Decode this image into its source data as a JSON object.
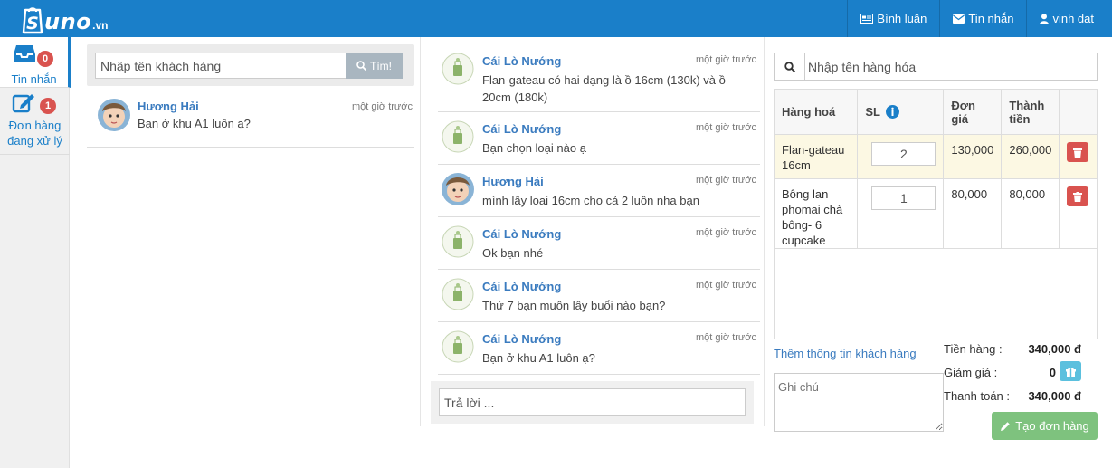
{
  "brand": {
    "name": "uno",
    "suffix": ".vn"
  },
  "topnav": {
    "comments": "Bình luận",
    "messages": "Tin nhắn",
    "user": "vinh dat"
  },
  "rail": [
    {
      "label": "Tin nhắn",
      "count": "0"
    },
    {
      "label_line1": "Đơn hàng",
      "label_line2": "đang xử lý",
      "count": "1"
    }
  ],
  "customers": {
    "search_placeholder": "Nhập tên khách hàng",
    "find_label": "Tìm!",
    "items": [
      {
        "name": "Hương Hải",
        "message": "Bạn ở khu A1 luôn ạ?",
        "time": "một giờ trước"
      }
    ]
  },
  "conversation": {
    "messages": [
      {
        "name": "Cái Lò Nướng",
        "text": "Flan-gateau có hai dạng là ồ 16cm (130k) và ồ 20cm (180k)",
        "time": "một giờ trước",
        "avatar": "shop"
      },
      {
        "name": "Cái Lò Nướng",
        "text": "Bạn chọn loại nào ạ",
        "time": "một giờ trước",
        "avatar": "shop"
      },
      {
        "name": "Hương Hải",
        "text": "mình lấy loai 16cm cho cả 2 luôn nha bạn",
        "time": "một giờ trước",
        "avatar": "customer"
      },
      {
        "name": "Cái Lò Nướng",
        "text": "Ok bạn nhé",
        "time": "một giờ trước",
        "avatar": "shop"
      },
      {
        "name": "Cái Lò Nướng",
        "text": "Thứ 7 bạn muốn lấy buổi nào bạn?",
        "time": "một giờ trước",
        "avatar": "shop"
      },
      {
        "name": "Cái Lò Nướng",
        "text": "Bạn ở khu A1 luôn ạ?",
        "time": "một giờ trước",
        "avatar": "shop"
      }
    ],
    "reply_placeholder": "Trả lời ..."
  },
  "order": {
    "search_placeholder": "Nhập tên hàng hóa",
    "headers": {
      "product": "Hàng hoá",
      "qty": "SL",
      "price": "Đơn giá",
      "total_line1": "Thành",
      "total_line2": "tiền"
    },
    "items": [
      {
        "name": "Flan-gateau 16cm",
        "qty": "2",
        "price": "130,000",
        "total": "260,000"
      },
      {
        "name": "Bông lan phomai chà bông- 6 cupcake",
        "qty": "1",
        "price": "80,000",
        "total": "80,000"
      }
    ],
    "add_customer_info": "Thêm thông tin khách hàng",
    "note_placeholder": "Ghi chú",
    "summary": {
      "subtotal_label": "Tiền hàng :",
      "subtotal": "340,000 đ",
      "discount_label": "Giảm giá :",
      "discount": "0",
      "payment_label": "Thanh toán :",
      "payment": "340,000 đ"
    },
    "create_button": "Tạo đơn hàng"
  },
  "colors": {
    "primary": "#1a7fc9",
    "danger": "#d9534f",
    "success": "#7ec27e",
    "info": "#5bc0de",
    "highlight": "#fcf8e3"
  }
}
